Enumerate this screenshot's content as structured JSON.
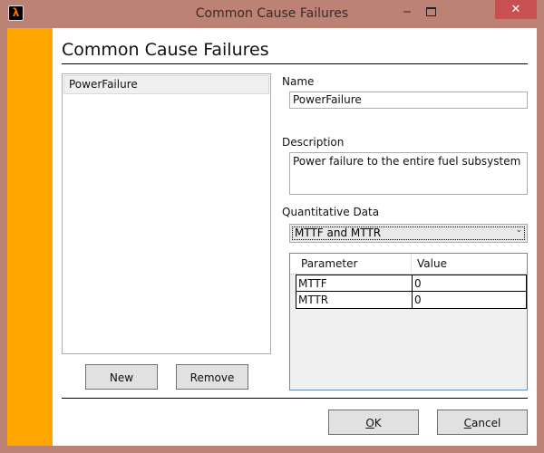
{
  "window": {
    "title": "Common Cause Failures",
    "app_icon": "lambda",
    "minimize_glyph": "‒",
    "close_glyph": "✕"
  },
  "colors": {
    "accent": "#ffa500",
    "frame": "#bd8276",
    "close": "#c75050"
  },
  "heading": "Common Cause Failures",
  "list": {
    "items": [
      {
        "label": "PowerFailure",
        "selected": true
      }
    ]
  },
  "buttons": {
    "new": "New",
    "remove": "Remove",
    "ok_mnemonic": "O",
    "ok_rest": "K",
    "cancel_mnemonic": "C",
    "cancel_rest": "ancel"
  },
  "form": {
    "name_label": "Name",
    "name_value": "PowerFailure",
    "description_label": "Description",
    "description_value": "Power failure to the entire fuel subsystem",
    "quantitative_label": "Quantitative Data",
    "quantitative_selected": "MTTF and MTTR"
  },
  "grid": {
    "columns": [
      "Parameter",
      "Value"
    ],
    "rows": [
      {
        "parameter": "MTTF",
        "value": "0"
      },
      {
        "parameter": "MTTR",
        "value": "0"
      }
    ]
  }
}
